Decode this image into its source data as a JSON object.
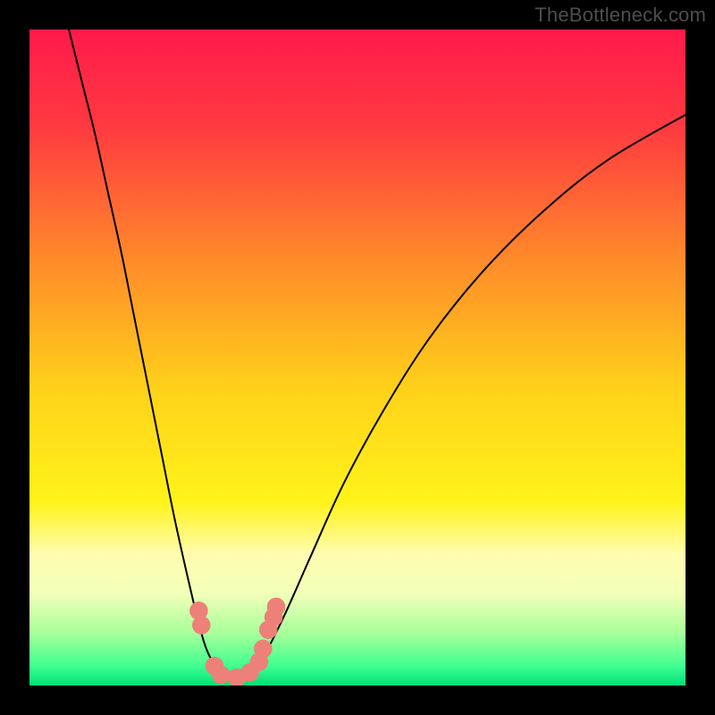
{
  "watermark": "TheBottleneck.com",
  "chart_data": {
    "type": "line",
    "title": "",
    "xlabel": "",
    "ylabel": "",
    "xlim": [
      0,
      1
    ],
    "ylim": [
      0,
      1
    ],
    "background_gradient_stops": [
      {
        "offset": 0.0,
        "color": "#ff1a4b"
      },
      {
        "offset": 0.15,
        "color": "#ff3a40"
      },
      {
        "offset": 0.35,
        "color": "#ff8a2a"
      },
      {
        "offset": 0.55,
        "color": "#ffd21a"
      },
      {
        "offset": 0.72,
        "color": "#fff31a"
      },
      {
        "offset": 0.8,
        "color": "#fffdb0"
      },
      {
        "offset": 0.86,
        "color": "#f2ffb8"
      },
      {
        "offset": 0.92,
        "color": "#a8ff9a"
      },
      {
        "offset": 0.97,
        "color": "#40ff90"
      },
      {
        "offset": 1.0,
        "color": "#00e078"
      }
    ],
    "curve_left": [
      {
        "x": 0.06,
        "y": 1.0
      },
      {
        "x": 0.08,
        "y": 0.92
      },
      {
        "x": 0.1,
        "y": 0.84
      },
      {
        "x": 0.12,
        "y": 0.75
      },
      {
        "x": 0.14,
        "y": 0.66
      },
      {
        "x": 0.16,
        "y": 0.56
      },
      {
        "x": 0.18,
        "y": 0.46
      },
      {
        "x": 0.2,
        "y": 0.36
      },
      {
        "x": 0.22,
        "y": 0.26
      },
      {
        "x": 0.24,
        "y": 0.17
      },
      {
        "x": 0.258,
        "y": 0.095
      },
      {
        "x": 0.272,
        "y": 0.05
      },
      {
        "x": 0.29,
        "y": 0.022
      },
      {
        "x": 0.31,
        "y": 0.01
      }
    ],
    "curve_right": [
      {
        "x": 0.31,
        "y": 0.01
      },
      {
        "x": 0.34,
        "y": 0.02
      },
      {
        "x": 0.36,
        "y": 0.05
      },
      {
        "x": 0.39,
        "y": 0.11
      },
      {
        "x": 0.43,
        "y": 0.2
      },
      {
        "x": 0.48,
        "y": 0.31
      },
      {
        "x": 0.54,
        "y": 0.42
      },
      {
        "x": 0.61,
        "y": 0.53
      },
      {
        "x": 0.69,
        "y": 0.63
      },
      {
        "x": 0.78,
        "y": 0.72
      },
      {
        "x": 0.88,
        "y": 0.8
      },
      {
        "x": 1.0,
        "y": 0.87
      }
    ],
    "markers": [
      {
        "x": 0.258,
        "y": 0.114
      },
      {
        "x": 0.262,
        "y": 0.092
      },
      {
        "x": 0.282,
        "y": 0.03
      },
      {
        "x": 0.292,
        "y": 0.016
      },
      {
        "x": 0.316,
        "y": 0.012
      },
      {
        "x": 0.336,
        "y": 0.02
      },
      {
        "x": 0.35,
        "y": 0.036
      },
      {
        "x": 0.356,
        "y": 0.056
      },
      {
        "x": 0.364,
        "y": 0.085
      },
      {
        "x": 0.372,
        "y": 0.104
      },
      {
        "x": 0.376,
        "y": 0.12
      }
    ],
    "marker_color": "#ed8079",
    "marker_radius": 0.014,
    "curve_color": "#000000",
    "curve_width": 2
  }
}
